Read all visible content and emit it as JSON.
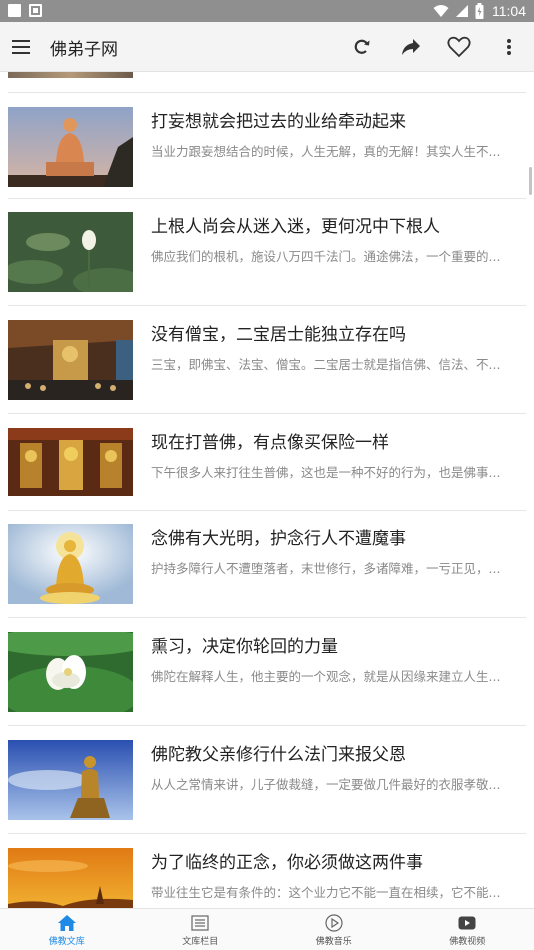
{
  "status_bar": {
    "time": "11:04"
  },
  "app_bar": {
    "title": "佛弟子网"
  },
  "articles": [
    {
      "title": "打妄想就会把过去的业给牵动起来",
      "summary": "当业力跟妄想结合的时候，人生无解，真的无解！其实人生不..."
    },
    {
      "title": "上根人尚会从迷入迷，更何况中下根人",
      "summary": "佛应我们的根机，施设八万四千法门。通途佛法，一个重要的..."
    },
    {
      "title": "没有僧宝，二宝居士能独立存在吗",
      "summary": "三宝，即佛宝、法宝、僧宝。二宝居士就是指信佛、信法、不..."
    },
    {
      "title": "现在打普佛，有点像买保险一样",
      "summary": "下午很多人来打往生普佛，这也是一种不好的行为，也是佛事..."
    },
    {
      "title": "念佛有大光明，护念行人不遭魔事",
      "summary": "护持多障行人不遭堕落者，末世修行，多诸障难，一亏正见，..."
    },
    {
      "title": "熏习，决定你轮回的力量",
      "summary": "佛陀在解释人生，他主要的一个观念，就是从因缘来建立人生..."
    },
    {
      "title": "佛陀教父亲修行什么法门来报父恩",
      "summary": "从人之常情来讲，儿子做裁缝，一定要做几件最好的衣服孝敬..."
    },
    {
      "title": "为了临终的正念，你必须做这两件事",
      "summary": "带业往生它是有条件的：这个业力它不能一直在相续，它不能..."
    }
  ],
  "bottom_nav": [
    {
      "label": "佛教文库",
      "icon": "home-icon",
      "active": true
    },
    {
      "label": "文库栏目",
      "icon": "list-icon",
      "active": false
    },
    {
      "label": "佛教音乐",
      "icon": "play-circle-icon",
      "active": false
    },
    {
      "label": "佛教视频",
      "icon": "video-icon",
      "active": false
    }
  ],
  "colors": {
    "accent": "#1f8ae6",
    "status_bar": "#8f8f8f",
    "app_bar": "#f4f4f4"
  }
}
